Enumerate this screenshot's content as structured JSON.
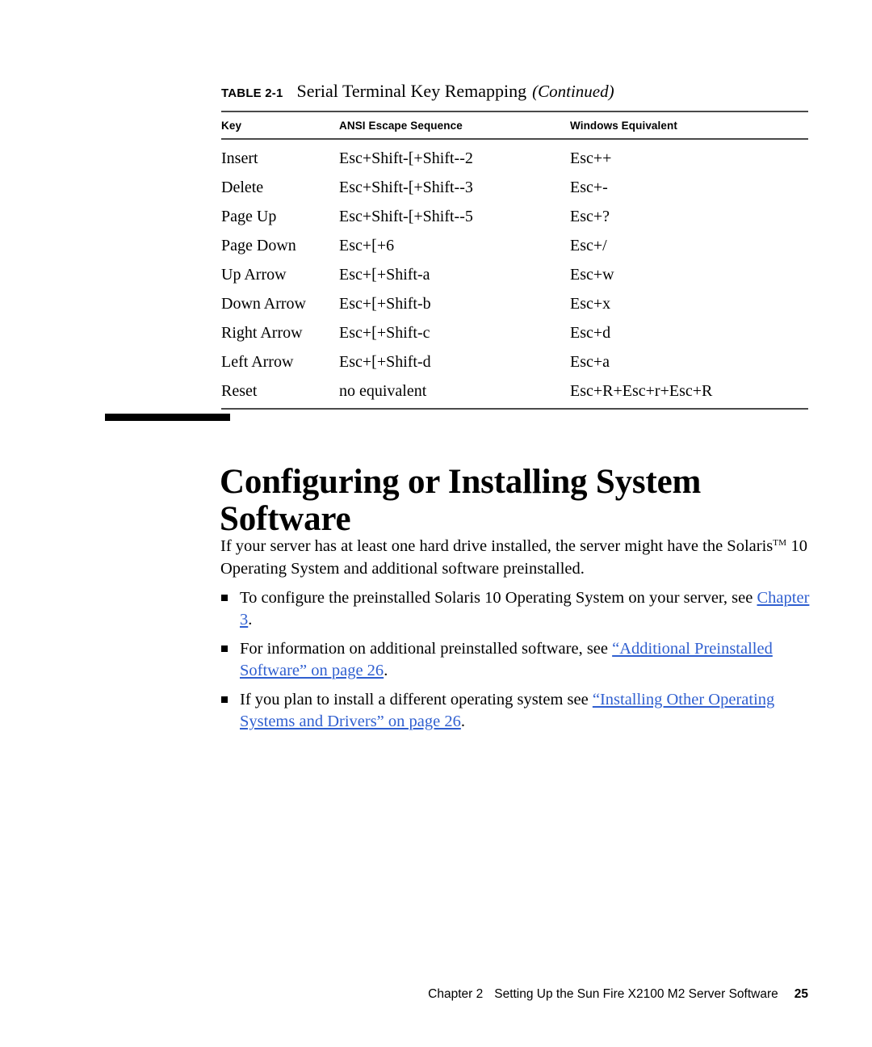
{
  "table": {
    "label": "TABLE 2-1",
    "title": "Serial Terminal Key Remapping",
    "continued": "(Continued)",
    "columns": [
      "Key",
      "ANSI Escape Sequence",
      "Windows Equivalent"
    ],
    "rows": [
      [
        "Insert",
        "Esc+Shift-[+Shift--2",
        "Esc++"
      ],
      [
        "Delete",
        "Esc+Shift-[+Shift--3",
        "Esc+-"
      ],
      [
        "Page Up",
        "Esc+Shift-[+Shift--5",
        "Esc+?"
      ],
      [
        "Page Down",
        "Esc+[+6",
        "Esc+/"
      ],
      [
        "Up Arrow",
        "Esc+[+Shift-a",
        "Esc+w"
      ],
      [
        "Down Arrow",
        "Esc+[+Shift-b",
        "Esc+x"
      ],
      [
        "Right Arrow",
        "Esc+[+Shift-c",
        "Esc+d"
      ],
      [
        "Left Arrow",
        "Esc+[+Shift-d",
        "Esc+a"
      ],
      [
        "Reset",
        "no equivalent",
        "Esc+R+Esc+r+Esc+R"
      ]
    ]
  },
  "chapter": {
    "heading": "Configuring or Installing System Software"
  },
  "body": {
    "intro_part1": "If your server has at least one hard drive installed, the server might have the Solaris",
    "intro_tm": "TM",
    "intro_part2": " 10 Operating System and additional software preinstalled.",
    "bullets": [
      {
        "text_before": "To configure the preinstalled Solaris 10 Operating System on your server, see ",
        "link": "Chapter 3",
        "text_after": "."
      },
      {
        "text_before": "For information on additional preinstalled software, see ",
        "link": "“Additional Preinstalled Software” on page 26",
        "text_after": "."
      },
      {
        "text_before": "If you plan to install a different operating system see ",
        "link": "“Installing Other Operating Systems and Drivers” on page 26",
        "text_after": "."
      }
    ]
  },
  "footer": {
    "chapter": "Chapter 2",
    "title": "Setting Up the Sun Fire X2100 M2 Server Software",
    "page": "25"
  },
  "colors": {
    "link": "#2f5fd0",
    "rule": "#4a4a4a",
    "text": "#000000"
  }
}
